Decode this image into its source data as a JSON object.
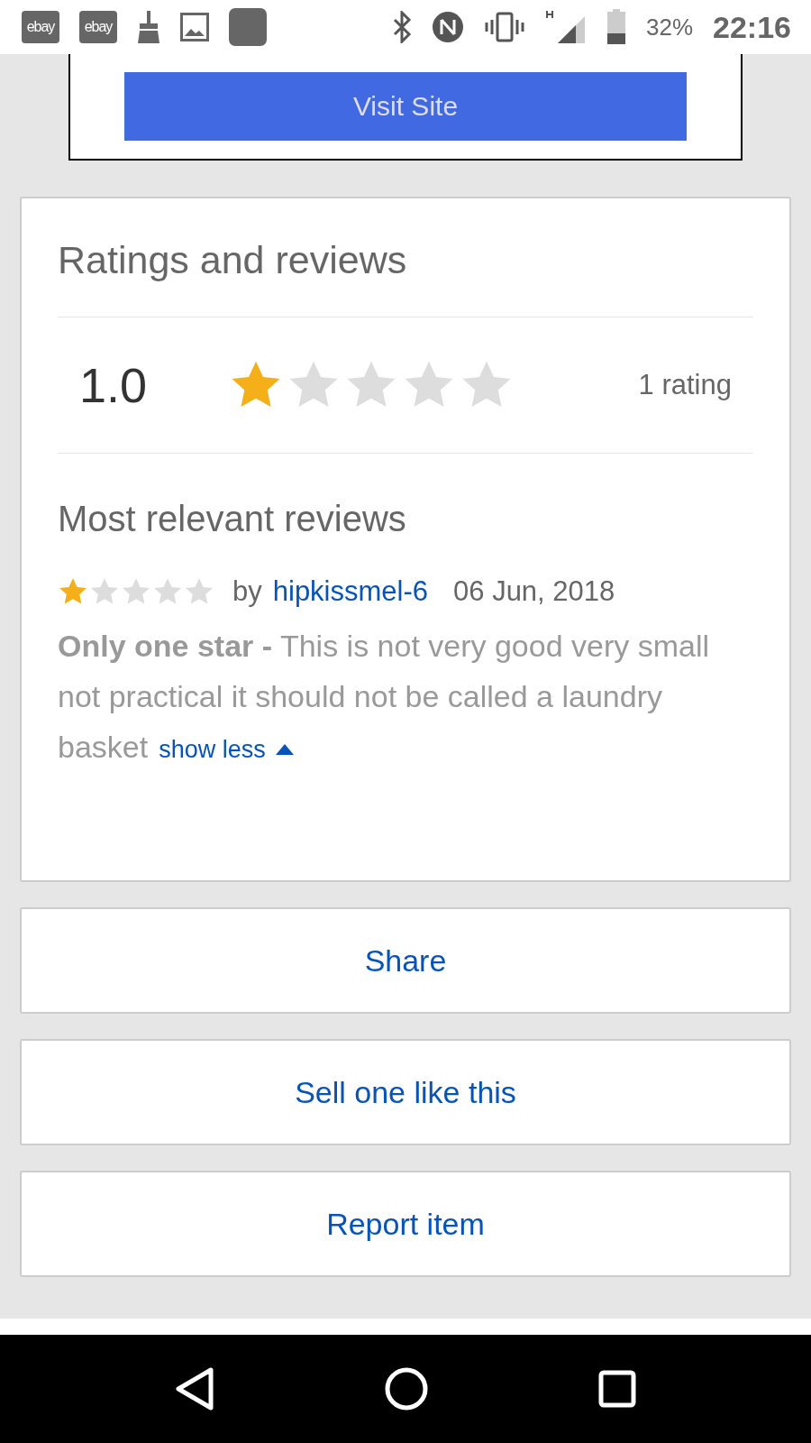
{
  "status_bar": {
    "notifications": [
      {
        "kind": "badge",
        "label": "ebay"
      },
      {
        "kind": "badge",
        "label": "ebay"
      },
      {
        "kind": "broom"
      },
      {
        "kind": "image"
      },
      {
        "kind": "square"
      }
    ],
    "battery": "32%",
    "time": "22:16"
  },
  "ad": {
    "button": "Visit Site"
  },
  "ratings": {
    "title": "Ratings and reviews",
    "average": "1.0",
    "stars": 1,
    "count": "1 rating",
    "reviews_title": "Most relevant reviews",
    "reviews": [
      {
        "stars": 1,
        "by": "by",
        "author": "hipkissmel-6",
        "date": "06 Jun, 2018",
        "text": "**Only one star -** This is not very good very small not practical it should not be called a laundry basket",
        "toggle": "show less",
        "expanded": true
      }
    ]
  },
  "actions": [
    "Share",
    "Sell one like this",
    "Report item"
  ]
}
